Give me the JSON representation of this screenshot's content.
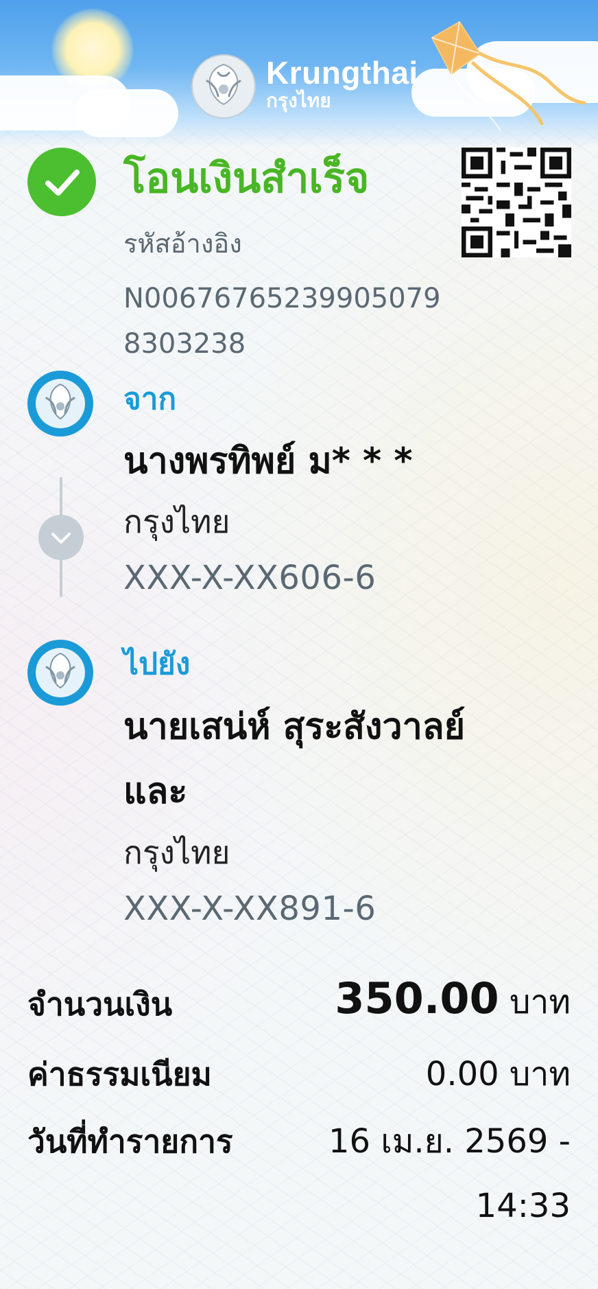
{
  "header": {
    "brand_en": "Krungthai",
    "brand_th": "กรุงไทย"
  },
  "status": {
    "title": "โอนเงินสำเร็จ",
    "ref_label": "รหัสอ้างอิง",
    "ref_code": "N00676765239905079 8303238"
  },
  "from": {
    "label": "จาก",
    "name": "นางพรทิพย์ ม* * *",
    "bank": "กรุงไทย",
    "account": "XXX-X-XX606-6"
  },
  "to": {
    "label": "ไปยัง",
    "name_line1": "นายเสน่ห์ สุระสังวาลย์",
    "name_line2": "และ",
    "bank": "กรุงไทย",
    "account": "XXX-X-XX891-6"
  },
  "summary": {
    "amount_label": "จำนวนเงิน",
    "amount_value": "350.00",
    "amount_unit": "บาท",
    "fee_label": "ค่าธรรมเนียม",
    "fee_value": "0.00 บาท",
    "date_label": "วันที่ทำรายการ",
    "date_line1": "16 เม.ย. 2569 -",
    "date_line2": "14:33"
  },
  "colors": {
    "success": "#4cbf31",
    "accent": "#1a9bd8",
    "muted": "#5a6873"
  },
  "icons": {
    "success": "check-icon",
    "qr": "qr-code-icon",
    "bank": "krungthai-bird-logo",
    "toggle": "chevron-down-icon"
  }
}
